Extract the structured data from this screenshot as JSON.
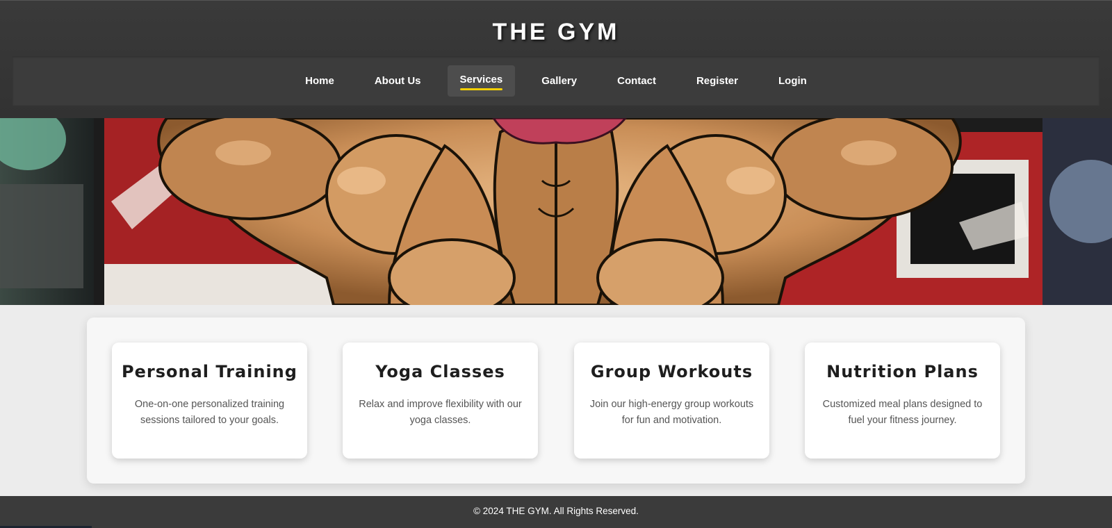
{
  "header": {
    "brand": "THE GYM"
  },
  "nav": {
    "items": [
      {
        "label": "Home",
        "active": false
      },
      {
        "label": "About Us",
        "active": false
      },
      {
        "label": "Services",
        "active": true
      },
      {
        "label": "Gallery",
        "active": false
      },
      {
        "label": "Contact",
        "active": false
      },
      {
        "label": "Register",
        "active": false
      },
      {
        "label": "Login",
        "active": false
      }
    ],
    "active_underline_color": "#f5d000"
  },
  "hero": {
    "image": "muscular-back-mural-illustration"
  },
  "services": [
    {
      "title": "Personal Training",
      "description": "One-on-one personalized training sessions tailored to your goals."
    },
    {
      "title": "Yoga Classes",
      "description": "Relax and improve flexibility with our yoga classes."
    },
    {
      "title": "Group Workouts",
      "description": "Join our high-energy group workouts for fun and motivation."
    },
    {
      "title": "Nutrition Plans",
      "description": "Customized meal plans designed to fuel your fitness journey."
    }
  ],
  "footer": {
    "copyright": "© 2024 THE GYM. All Rights Reserved."
  },
  "colors": {
    "header_bg": "#333333",
    "nav_bg": "#3c3c3c",
    "page_bg": "#ececec",
    "footer_bg": "#3b3b3b"
  }
}
